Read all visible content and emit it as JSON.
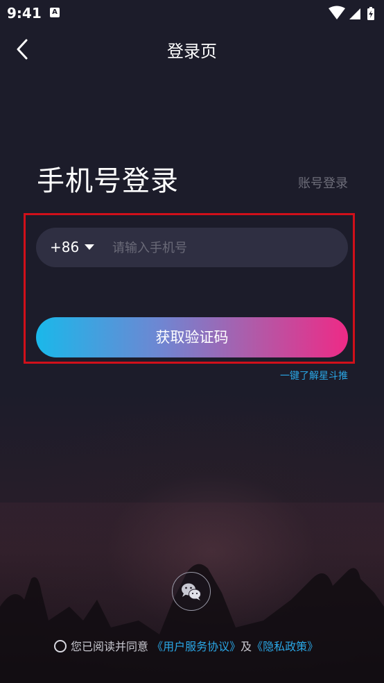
{
  "status_bar": {
    "time": "9:41",
    "notification_letter": "A"
  },
  "header": {
    "title": "登录页"
  },
  "login": {
    "title": "手机号登录",
    "account_login": "账号登录",
    "country_code": "+86",
    "phone_placeholder": "请输入手机号",
    "get_code_label": "获取验证码",
    "learn_more": "一键了解星斗推"
  },
  "agreement": {
    "prefix": "您已阅读并同意",
    "user_agreement": "《用户服务协议》",
    "conjunction": "及",
    "privacy_policy": "《隐私政策》"
  },
  "colors": {
    "background": "#1c1c2a",
    "field": "#2f2f42",
    "link": "#2aa7e6",
    "highlight": "#d0101a",
    "gradient_start": "#1ab8ea",
    "gradient_end": "#ee2a86"
  }
}
